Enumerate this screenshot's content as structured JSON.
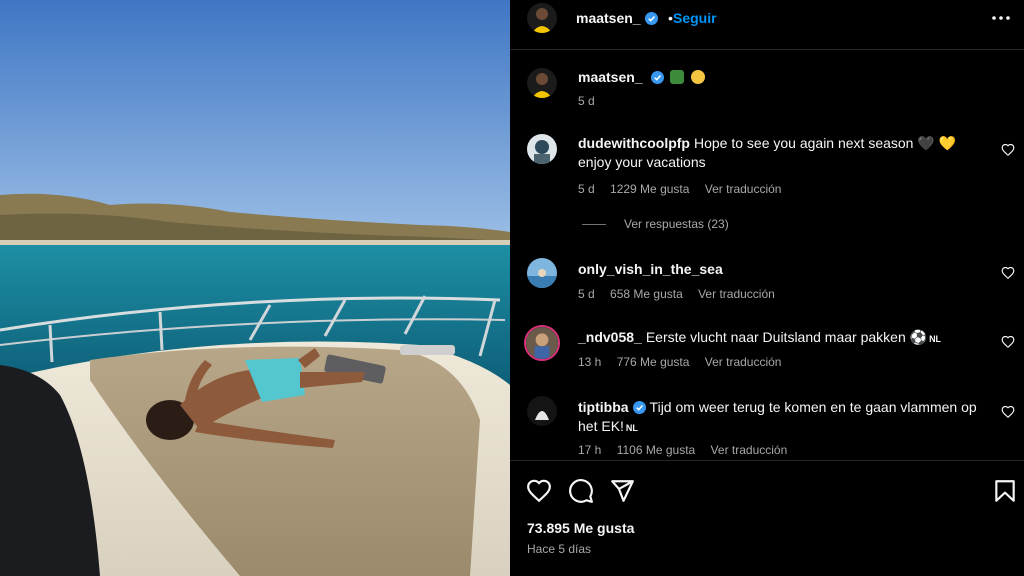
{
  "post": {
    "author": "maatsen_",
    "follow_label": "Seguir",
    "follow_separator": "•",
    "likes_label": "73.895 Me gusta",
    "time_label": "Hace 5 días"
  },
  "caption": {
    "username": "maatsen_",
    "time": "5 d",
    "emojis": [
      "palm-island-emoji",
      "sun-emoji"
    ]
  },
  "comments": [
    {
      "username": "dudewithcoolpfp",
      "text": "Hope to see you again next season 🖤 💛 enjoy your vacations",
      "time": "5 d",
      "likes": "1229 Me gusta",
      "translate": "Ver traducción",
      "verified": false
    },
    {
      "username": "only_vish_in_the_sea",
      "text": "",
      "time": "5 d",
      "likes": "658 Me gusta",
      "translate": "Ver traducción",
      "verified": false
    },
    {
      "username": "_ndv058_",
      "text": "Eerste vlucht naar Duitsland maar pakken ⚽",
      "badge": "NL",
      "time": "13 h",
      "likes": "776 Me gusta",
      "translate": "Ver traducción",
      "verified": false
    },
    {
      "username": "tiptibba",
      "text": "Tijd om weer terug te komen en te gaan vlammen op het EK!",
      "badge": "NL",
      "time": "17 h",
      "likes": "1106 Me gusta",
      "translate": "Ver traducción",
      "verified": true
    }
  ],
  "replies_label": "Ver respuestas (23)",
  "icons": {
    "verified_color": "#3897f0",
    "accent_link": "#0095f6"
  }
}
